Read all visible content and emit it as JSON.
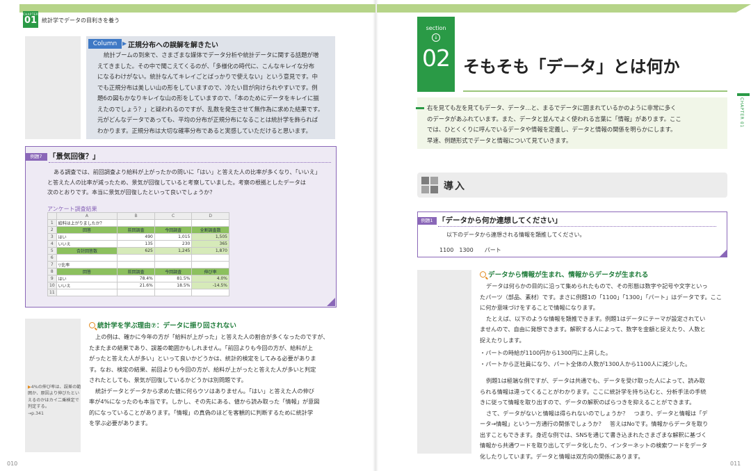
{
  "left_page": {
    "chapter_tab": {
      "small": "CHAPTER",
      "num": "01"
    },
    "running_head": "統計学でデータの目利きを養う",
    "column": {
      "label": "Column",
      "title": "正規分布への誤解を解きたい",
      "lines": [
        "統計ブームの到来で、さまざまな媒体でデータ分析や統計データに関する話題が増",
        "えてきました。その中で聞こえてくるのが、「多様化の時代に、こんなキレイな分布",
        "になるわけがない。統計なんてキレイごとばっかりで使えない」という意見です。中",
        "でも正規分布は美しい山の形をしていますので、冷たい目が向けられやすいです。例",
        "題6の図もかなりキレイな山の形をしていますので、「本のためにデータをキレイに揃",
        "えたのでしょう？」と疑われるのですが、乱数を発生させて無作為に求めた結果です。",
        "元がどんなデータであっても、平均の分布が正規分布になることは統計学を飾られば",
        "わかります。正規分布は大切な確率分布であると実感していただけると思います。"
      ]
    },
    "example7": {
      "tag": "例題7",
      "title": "「景気回復？」",
      "lines": [
        "ある調査では、前回調査より給料が上がったかの問いに「はい」と答えた人の比率が多くなり、「いいえ」",
        "と答えた人の比率が減ったため、景気が回復していると考察していました。考察の根拠としたデータは",
        "次のとおりです。本当に景気が回復したといって良いでしょうか？"
      ],
      "survey_label": "アンケート調査結果",
      "sheet": {
        "columns": [
          "",
          "A",
          "B",
          "C",
          "D"
        ],
        "rows": [
          [
            "1",
            "給料は上がりましたか？",
            "",
            "",
            ""
          ],
          [
            "2",
            "回答",
            "前回調査",
            "今回調査",
            "全割調査数"
          ],
          [
            "3",
            "はい",
            "490",
            "1,015",
            "1,505"
          ],
          [
            "4",
            "いいえ",
            "135",
            "230",
            "365"
          ],
          [
            "5",
            "合計回答数",
            "625",
            "1,245",
            "1,870"
          ],
          [
            "6",
            "",
            "",
            "",
            ""
          ],
          [
            "7",
            "▽比率",
            "",
            "",
            ""
          ],
          [
            "8",
            "回答",
            "前回調査",
            "今回調査",
            "伸び率"
          ],
          [
            "9",
            "はい",
            "78.4%",
            "81.5%",
            "4.0%"
          ],
          [
            "10",
            "いいえ",
            "21.6%",
            "18.5%",
            "-14.5%"
          ],
          [
            "11",
            "",
            "",
            "",
            ""
          ]
        ]
      }
    },
    "reason": {
      "title": "統計学を学ぶ理由⑦：データに振り回されない",
      "lines": [
        "上の例は、確かに今年の方が「給料が上がった」と答えた人の割合が多くなったのですが、",
        "たまたまの結果であり、誤差の範囲かもしれません。「前回よりも今回の方が、給料が上",
        "がったと答えた人が多い」といって良いかどうかは、統計的検定をしてみる必要がありま",
        "す。なお、検定の結果、前回よりも今回の方が、給料が上がったと答えた人が多いと判定",
        "されたとしても、景気が回復しているかどうかは別問題です。",
        "統計データとデータから求めた値に何らウソはありません。「はい」と答えた人の伸び",
        "率が4%になったのも本当です。しかし、その先にある、値から読み取った「情報」が意図",
        "的になっていることがあります。「情報」の真偽のほどを客観的に判断するために統計学",
        "を学ぶ必要があります。"
      ]
    },
    "sidenote": {
      "mark": "▶",
      "text": "4%の伸び率は、誤差の範囲か、原因より伸びたといえるのかはカイ二乗検定で判定する。",
      "ref": "→p.341"
    },
    "folio": "010"
  },
  "right_page": {
    "section": {
      "label": "section",
      "arrow": "↓",
      "num": "02"
    },
    "title": "そもそも「データ」とは何か",
    "chapter_side": "CHAPTER 01",
    "intro": [
      "右を見ても左を見てもデータ、データ…と、まるでデータに囲まれているかのように非常に多く",
      "のデータがあふれています。また、データと並んでよく使われる言葉に「情報」があります。ここ",
      "では、ひとくくりに呼んでいるデータや情報を定義し、データと情報の関係を明らかにします。",
      "早速、例題形式でデータと情報について見ていきます。"
    ],
    "intro_section": "導入",
    "example1": {
      "tag": "例題1",
      "title": "「データから何か連想してください」",
      "instruction": "以下のデータから連想される情報を類推してください。",
      "data": "1100　1300　　パート"
    },
    "info": {
      "title": "データから情報が生まれ、情報からデータが生まれる",
      "para1": [
        "データは何らかの目的に沿って集められたもので、その形態は数字や記号や文字といっ",
        "たパーツ（部品、素材）です。まさに例題1の「1100」「1300」「パート」はデータです。ここ",
        "に何か意味づけをすることで情報になります。",
        "たとえば、以下のような情報を類推できます。例題1はデータにテーマが設定されてい",
        "ませんので、自由に発想できます。解釈する人によって、数字を金額と捉えたり、人数と",
        "捉えたりします。"
      ],
      "bullets": [
        "・パートの時給が1100円から1300円に上昇した。",
        "・パートから正社員になり、パート全体の人数が1300人から1100人に減少した。"
      ],
      "para2": [
        "例題1は極端な例ですが、データは共通でも、データを受け取った人によって、読み取",
        "られる情報は違ってくることがわかります。ここに統計学を持ち込むと、分析手法の手続",
        "きに従って情報を取り出すので、データの解釈のばらつきを抑えることができます。",
        "さて、データがないと情報は得られないのでしょうか？　つまり、データと情報は「デ",
        "ータ→情報」という一方通行の関係でしょうか？　答えはNoです。情報からデータを取り",
        "出すこともできます。身近な例では、SNSを通じて書き込まれたさまざまな解釈に基づく",
        "情報から共通ワードを取り出してデータ化したり、インターネットの検索ワードをデータ",
        "化したりしています。データと情報は双方向の関係にあります。"
      ]
    },
    "folio": "011"
  },
  "colors": {
    "green": "#2a9a46",
    "light_green": "#b6d489",
    "purple": "#8a67b8",
    "blue": "#3f79c5",
    "orange": "#e28a1c"
  }
}
